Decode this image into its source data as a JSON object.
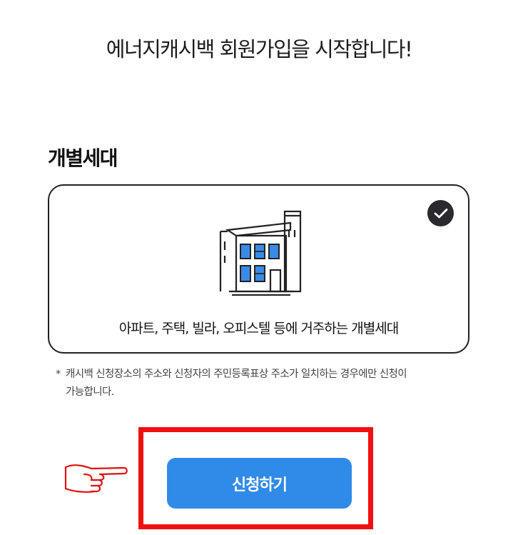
{
  "header": {
    "title": "에너지캐시백 회원가입을 시작합니다!"
  },
  "section": {
    "title": "개별세대"
  },
  "option_card": {
    "description": "아파트, 주택, 빌라, 오피스텔 등에 거주하는 개별세대",
    "selected": true,
    "icon": "building-icon",
    "check_icon": "check-circle-icon"
  },
  "notice": {
    "star": "*",
    "line1": "캐시백 신청장소의 주소와 신청자의 주민등록표상 주소가 일치하는 경우에만 신청이",
    "line2": "가능합니다."
  },
  "actions": {
    "apply_label": "신청하기",
    "pointer_icon": "pointing-hand-icon"
  },
  "colors": {
    "accent": "#2f8ae8",
    "highlight": "#f01010",
    "window": "#3a8be6"
  }
}
